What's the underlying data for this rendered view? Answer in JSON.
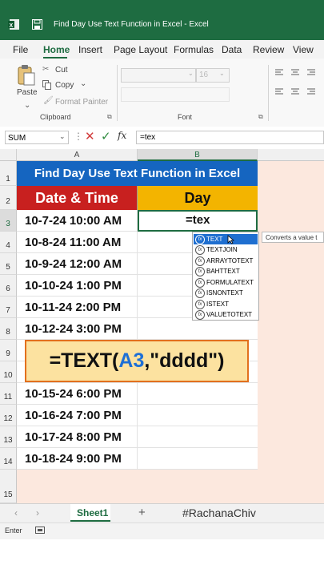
{
  "title_bar": {
    "window_title": "Find Day Use Text Function in Excel  -  Excel"
  },
  "menu": [
    "File",
    "Home",
    "Insert",
    "Page Layout",
    "Formulas",
    "Data",
    "Review",
    "View"
  ],
  "ribbon": {
    "paste": "Paste",
    "cut": "Cut",
    "copy": "Copy",
    "format_painter": "Format Painter",
    "clipboard_label": "Clipboard",
    "font_size": "16",
    "font_label": "Font"
  },
  "formula_bar": {
    "name_box": "SUM",
    "fx": "fx",
    "formula": "=tex"
  },
  "columns": [
    "A",
    "B"
  ],
  "rows": [
    "1",
    "2",
    "3",
    "4",
    "5",
    "6",
    "7",
    "8",
    "9",
    "10",
    "11",
    "12",
    "13",
    "14",
    "15"
  ],
  "sheet": {
    "title": "Find Day Use Text Function in Excel",
    "header_a": "Date & Time",
    "header_b": "Day",
    "editing_value": "=tex",
    "dates": [
      "10-7-24 10:00 AM",
      "10-8-24 11:00 AM",
      "10-9-24 12:00 AM",
      "10-10-24 1:00 PM",
      "10-11-24 2:00 PM",
      "10-12-24 3:00 PM",
      "10-15-24 6:00 PM",
      "10-16-24 7:00 PM",
      "10-17-24 8:00 PM",
      "10-18-24 9:00 PM"
    ]
  },
  "autocomplete": {
    "items": [
      "TEXT",
      "TEXTJOIN",
      "ARRAYTOTEXT",
      "BAHTTEXT",
      "FORMULATEXT",
      "ISNONTEXT",
      "ISTEXT",
      "VALUETOTEXT"
    ],
    "tooltip": "Converts a value t"
  },
  "banner": {
    "prefix": "=TEXT(",
    "ref": "A3",
    "suffix": ",\"dddd\")"
  },
  "tabs": {
    "sheet": "Sheet1",
    "add": "+",
    "watermark": "#RachanaChiv"
  },
  "status": {
    "mode": "Enter"
  },
  "colors": {
    "title_fill": "#1565c0",
    "header_a": "#c8201f",
    "header_b": "#f3b400",
    "accent": "#1e6c41",
    "banner_bg": "#fce2a0",
    "banner_border": "#e2701e",
    "ref_color": "#1d6fd6"
  }
}
